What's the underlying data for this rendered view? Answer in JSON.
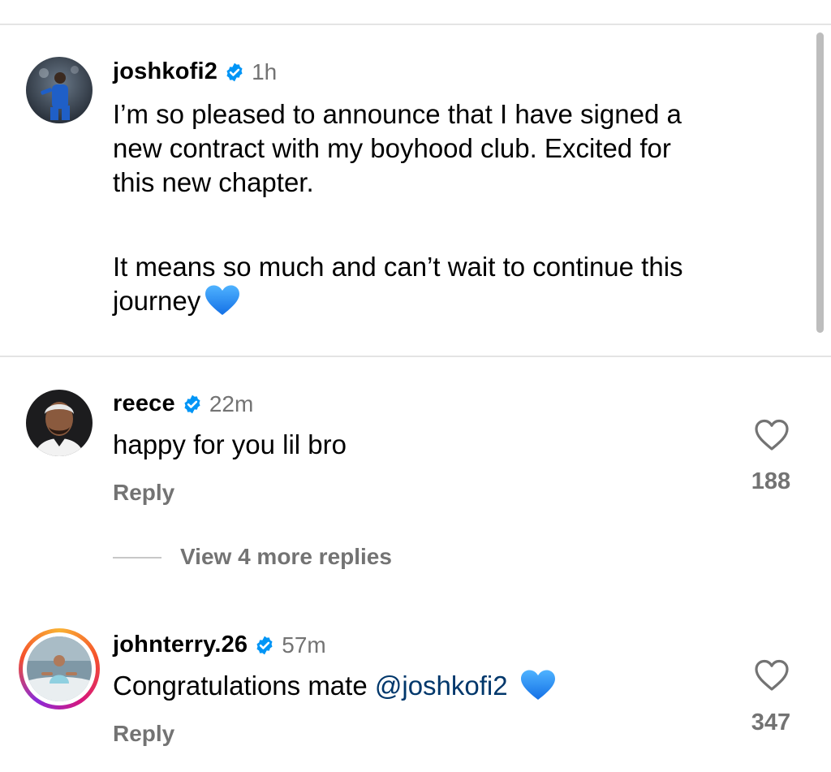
{
  "post": {
    "username": "joshkofi2",
    "time": "1h",
    "paragraph1": "I’m so pleased to announce that I have signed a\nnew contract with my boyhood club. Excited for\nthis new chapter.",
    "paragraph2": "It means so much and can’t wait to continue this\njourney",
    "avatar_icon": "player-photo-avatar"
  },
  "comments": [
    {
      "username": "reece",
      "time": "22m",
      "text": "happy for you lil bro",
      "reply_label": "Reply",
      "likes": "188",
      "view_replies_label": "View 4 more replies"
    },
    {
      "username": "johnterry.26",
      "time": "57m",
      "text": "Congratulations mate ",
      "mention": "@joshkofi2",
      "reply_label": "Reply",
      "likes": "347"
    }
  ],
  "colors": {
    "verified": "#0095f6",
    "secondary_text": "#737373",
    "mention": "#00376b",
    "heart_emoji": "#1e90ff"
  }
}
